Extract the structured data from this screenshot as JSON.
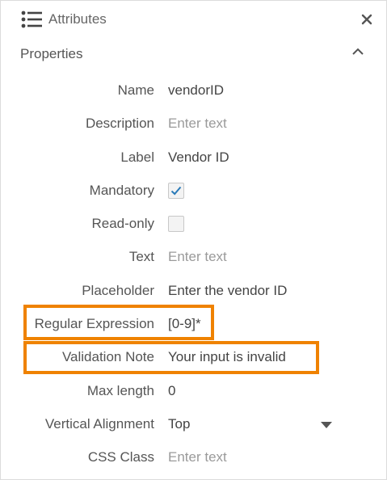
{
  "header": {
    "title": "Attributes",
    "list_icon": "list-icon",
    "close_icon": "close-icon"
  },
  "section": {
    "title": "Properties",
    "toggle_icon": "chevron-up-icon"
  },
  "fields": {
    "name": {
      "label": "Name",
      "value": "vendorID"
    },
    "description": {
      "label": "Description",
      "placeholder": "Enter text"
    },
    "label": {
      "label": "Label",
      "value": "Vendor ID"
    },
    "mandatory": {
      "label": "Mandatory",
      "checked": true
    },
    "readonly": {
      "label": "Read-only",
      "checked": false
    },
    "text": {
      "label": "Text",
      "placeholder": "Enter text"
    },
    "placeholder": {
      "label": "Placeholder",
      "value": "Enter the vendor ID"
    },
    "regex": {
      "label": "Regular Expression",
      "value": "[0-9]*"
    },
    "validation_note": {
      "label": "Validation Note",
      "value": "Your input is invalid"
    },
    "max_length": {
      "label": "Max length",
      "value": "0"
    },
    "vertical_alignment": {
      "label": "Vertical Alignment",
      "value": "Top"
    },
    "css_class": {
      "label": "CSS Class",
      "placeholder": "Enter text"
    }
  },
  "colors": {
    "highlight": "#ef8200",
    "checkmark": "#2a7ab8",
    "border": "#dcdcdc"
  }
}
